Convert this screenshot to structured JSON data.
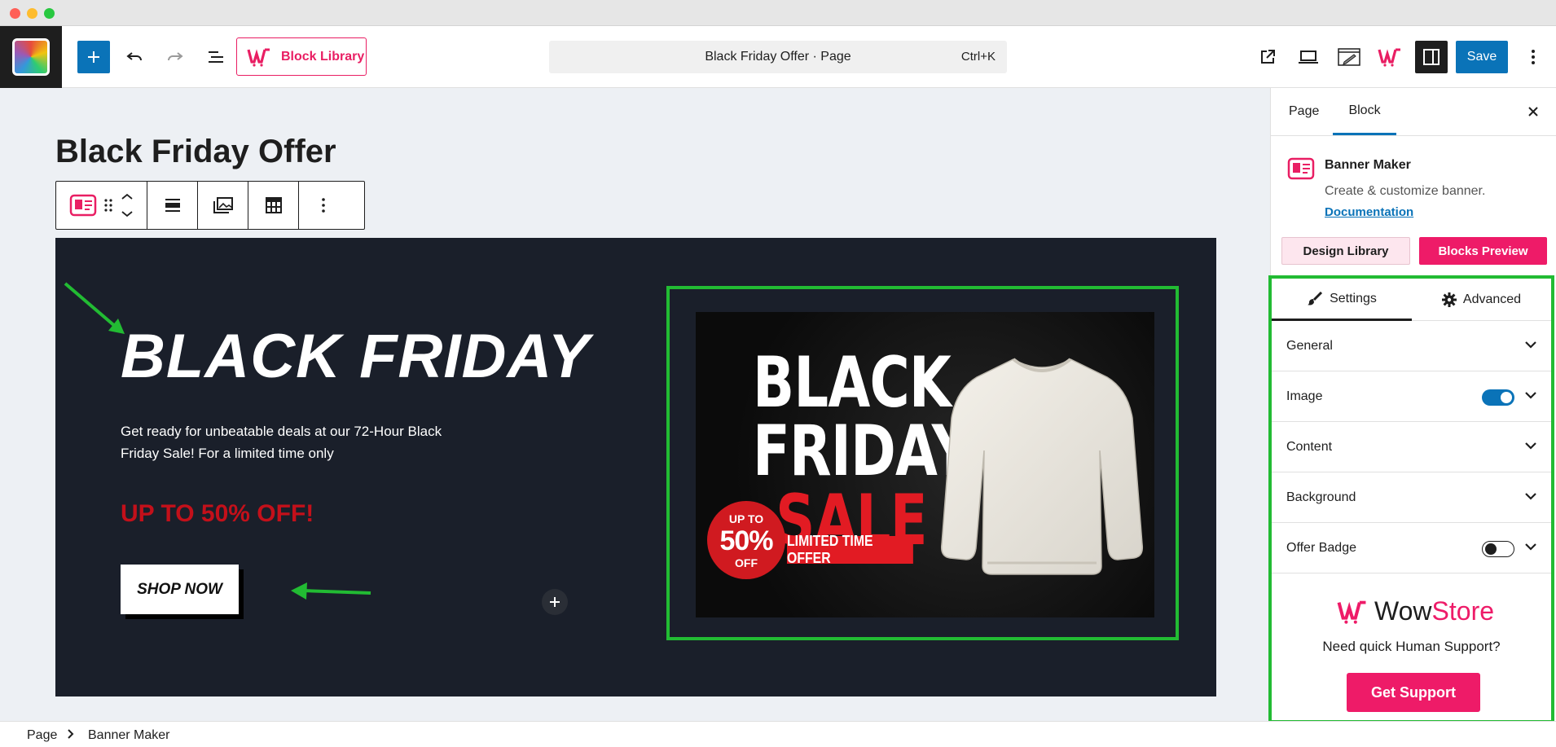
{
  "toolbar": {
    "block_library_label": "Block Library",
    "document_title": "Black Friday Offer · Page",
    "shortcut": "Ctrl+K",
    "save_label": "Save"
  },
  "editor": {
    "page_title": "Black Friday Offer"
  },
  "banner": {
    "title": "BLACK FRIDAY",
    "description": "Get ready for unbeatable deals at our 72-Hour Black Friday Sale! For a limited time only",
    "offer": "UP TO 50% OFF!",
    "button_label": "SHOP NOW",
    "image_text": {
      "line1": "BLACK",
      "line2": "FRIDAY",
      "line3": "SALE",
      "badge_top": "UP TO",
      "badge_value": "50%",
      "badge_bottom": "OFF",
      "ribbon": "LIMITED TIME OFFER"
    }
  },
  "sidebar": {
    "tabs": {
      "page": "Page",
      "block": "Block"
    },
    "block_info": {
      "name": "Banner Maker",
      "description": "Create & customize banner.",
      "doc_link": "Documentation"
    },
    "design_library_label": "Design Library",
    "blocks_preview_label": "Blocks Preview",
    "settings_tabs": {
      "settings": "Settings",
      "advanced": "Advanced"
    },
    "panels": [
      {
        "label": "General"
      },
      {
        "label": "Image",
        "toggle": true
      },
      {
        "label": "Content"
      },
      {
        "label": "Background"
      },
      {
        "label": "Offer Badge",
        "toggle": false
      }
    ],
    "brand": {
      "wow": "Wow",
      "store": "Store"
    },
    "support_question": "Need quick Human Support?",
    "support_button": "Get Support"
  },
  "footer": {
    "breadcrumb": [
      "Page",
      "Banner Maker"
    ]
  },
  "colors": {
    "accent_blue": "#0a73b8",
    "brand_pink": "#ee1b68",
    "banner_bg": "#1a1f2a",
    "offer_red": "#c3101a",
    "annotation_green": "#22bb33"
  },
  "icons": {
    "toolbar": [
      "plus-icon",
      "undo-icon",
      "redo-icon",
      "list-view-icon",
      "wowstore-logo-icon",
      "external-link-icon",
      "laptop-preview-icon",
      "edit-icon",
      "sidebar-toggle-icon",
      "more-options-icon"
    ],
    "block_toolbar": [
      "banner-block-icon",
      "drag-handle-icon",
      "move-arrows-icon",
      "align-icon",
      "image-gallery-icon",
      "layout-table-icon",
      "kebab-icon"
    ]
  }
}
